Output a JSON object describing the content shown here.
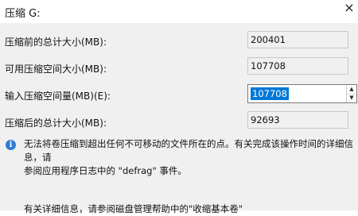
{
  "window": {
    "title": "压缩 G:",
    "close_glyph": "×"
  },
  "fields": {
    "total_before": {
      "label": "压缩前的总计大小(MB):",
      "value": "200401"
    },
    "available": {
      "label": "可用压缩空间大小(MB):",
      "value": "107708"
    },
    "input": {
      "label": "输入压缩空间量(MB)(E):",
      "value": "107708",
      "up": "▲",
      "down": "▼"
    },
    "total_after": {
      "label": "压缩后的总计大小(MB):",
      "value": "92693"
    }
  },
  "info": {
    "icon": "info-icon",
    "icon_glyph": "i",
    "line1": "无法将卷压缩到超出任何不可移动的文件所在的点。有关完成该操作时间的详细信息，请",
    "line2": "参阅应用程序日志中的 \"defrag\" 事件。",
    "more": "有关详细信息，请参阅磁盘管理帮助中的\"收缩基本卷\""
  }
}
